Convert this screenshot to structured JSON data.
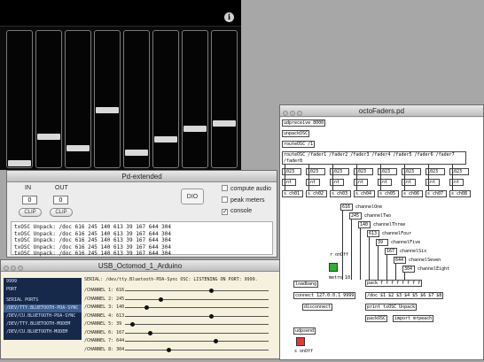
{
  "touchosc": {
    "info_label": "i",
    "fader_levels": [
      0.0,
      0.21,
      0.12,
      0.42,
      0.08,
      0.19,
      0.27,
      0.31
    ]
  },
  "pd_extended": {
    "title": "Pd-extended",
    "in_label": "IN",
    "out_label": "OUT",
    "in_value": "0",
    "out_value": "0",
    "clip_label": "CLIP",
    "dio_label": "DIO",
    "compute_audio": "compute audio",
    "peak_meters": "peak meters",
    "console_label": "console",
    "console_lines": [
      "txOSC Unpack: /doc 616 245 140 613 39 167 644 304",
      "txOSC Unpack: /doc 616 245 140 613 39 167 644 304",
      "txOSC Unpack: /doc 616 245 140 613 39 167 644 304",
      "txOSC Unpack: /doc 616 245 140 613 39 167 644 304",
      "txOSC Unpack: /doc 616 245 140 613 39 167 644 304"
    ]
  },
  "usb_window": {
    "title": "USB_Octomod_1_Arduino",
    "port_value": "9999",
    "port_label": "PORT",
    "ports": [
      "SERIAL PORTS",
      "/DEV/TTY.BLUETOOTH-PDA-SYNC",
      "/DEV/CU.BLUETOOTH-PDA-SYNC",
      "/DEV/TTY.BLUETOOTH-MODEM",
      "/DEV/CU.BLUETOOTH-MODEM"
    ],
    "serial_line": "SERIAL: /dev/tty.Bluetooth-PDA-Sync OSC: LISTENING ON PORT: 9999.",
    "channels": [
      {
        "label": "/CHANNEL 1: 616",
        "level": 0.616
      },
      {
        "label": "/CHANNEL 2: 245",
        "level": 0.245
      },
      {
        "label": "/CHANNEL 3: 140",
        "level": 0.14
      },
      {
        "label": "/CHANNEL 4: 613",
        "level": 0.613
      },
      {
        "label": "/CHANNEL 5: 39",
        "level": 0.039
      },
      {
        "label": "/CHANNEL 6: 167",
        "level": 0.167
      },
      {
        "label": "/CHANNEL 7: 644",
        "level": 0.644
      },
      {
        "label": "/CHANNEL 8: 304",
        "level": 0.304
      }
    ]
  },
  "octo": {
    "title": "octoFaders.pd",
    "udpreceive": "udpreceive 8000",
    "unpackosc": "unpackOSC",
    "routeosc1": "routeOSC /1",
    "routefaders": "routeOSC /fader1 /fader2 /fader3 /fader4 /fader5 /fader6 /fader7 /fader8",
    "nums": [
      "1023",
      "1023",
      "1023",
      "1023",
      "1023",
      "1023",
      "1023",
      "1023"
    ],
    "int": "int",
    "sends": [
      "s ch01",
      "s ch02",
      "s ch03",
      "s ch04",
      "s ch05",
      "s ch06",
      "s ch07",
      "s ch08"
    ],
    "channel_values": [
      "616",
      "245",
      "140",
      "613",
      "39",
      "167",
      "644",
      "304"
    ],
    "channel_names": [
      "channelOne",
      "channelTwo",
      "channelThree",
      "channelFour",
      "channelFive",
      "channelSix",
      "channelSeven",
      "channelEight"
    ],
    "r_onoff": "r onOff",
    "loadbang": "loadbang",
    "metro": "metro 10",
    "pack": "pack f f f f f f f f",
    "connect": "connect 127.0.0.1 9999",
    "doc": "/doc $1 $2 $3 $4 $5 $6 $7 $8",
    "disconnect": "disconnect",
    "print": "print txOSC Unpack",
    "packosc": "packOSC",
    "import": "import mrpeach",
    "udpsend": "udpsend",
    "s_onoff": "s onOff"
  }
}
